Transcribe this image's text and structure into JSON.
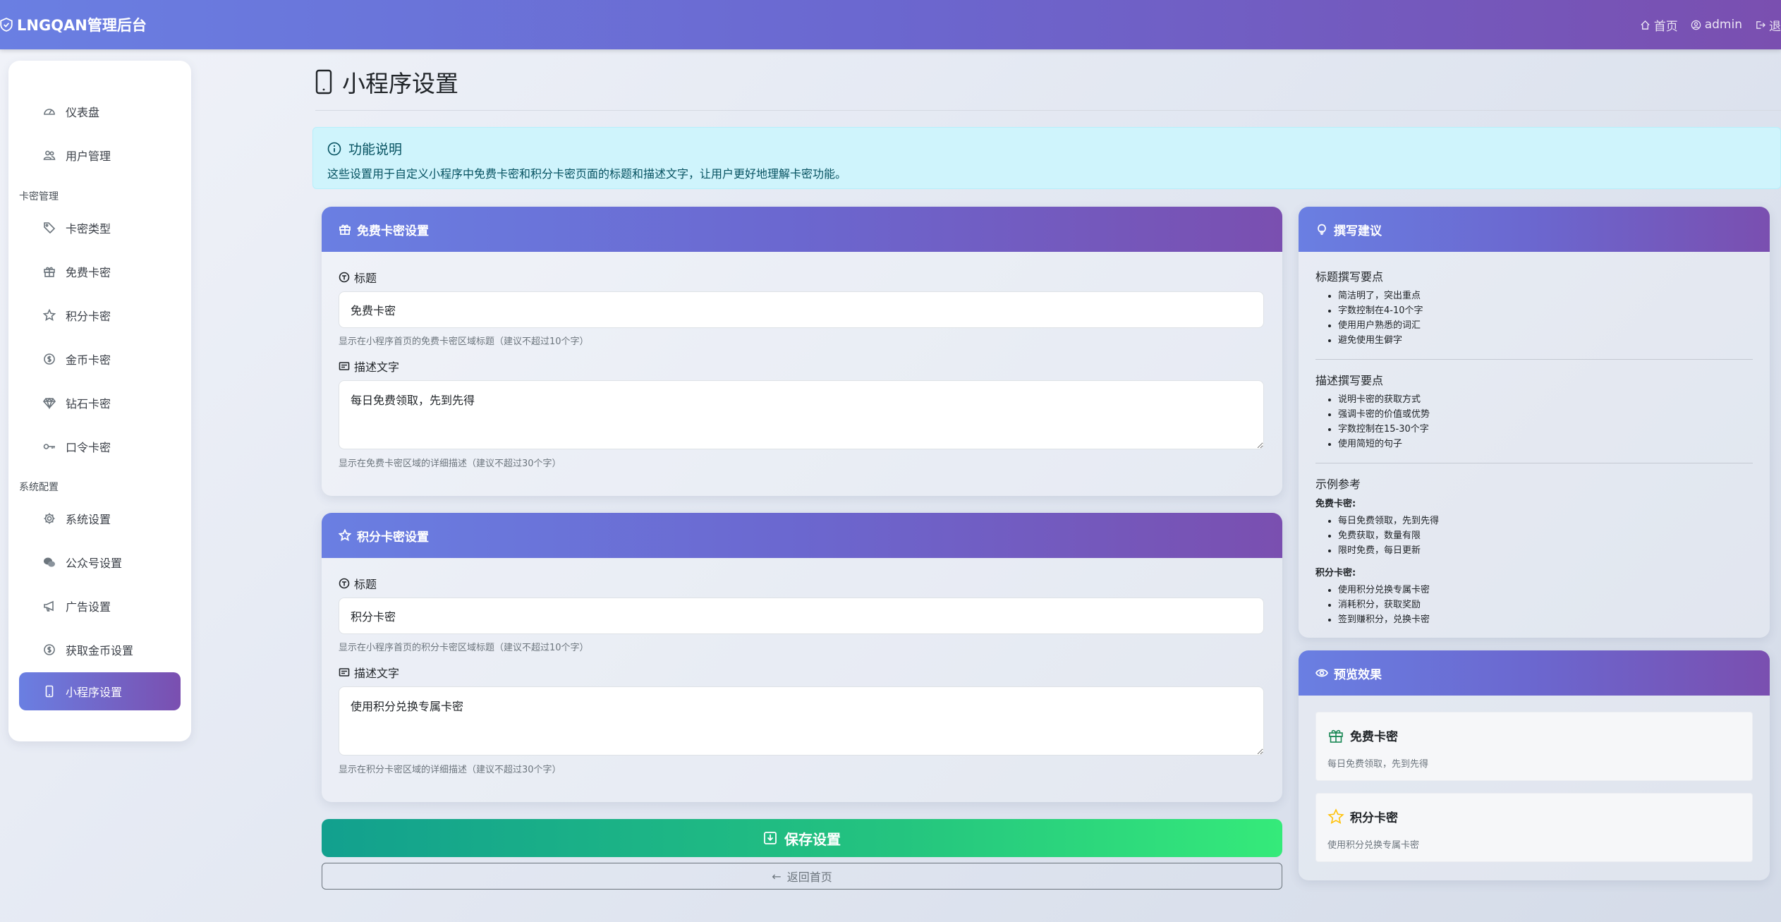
{
  "navbar": {
    "brand": "LNGQAN管理后台",
    "home": "首页",
    "user": "admin",
    "logout": "退"
  },
  "sidebar": {
    "items": [
      {
        "label": "仪表盘",
        "icon": "gauge-icon"
      },
      {
        "label": "用户管理",
        "icon": "people-icon"
      },
      {
        "label": "卡密类型",
        "icon": "tags-icon"
      },
      {
        "label": "免费卡密",
        "icon": "gift-icon"
      },
      {
        "label": "积分卡密",
        "icon": "star-icon"
      },
      {
        "label": "金币卡密",
        "icon": "coin-icon"
      },
      {
        "label": "钻石卡密",
        "icon": "gem-icon"
      },
      {
        "label": "口令卡密",
        "icon": "key-icon"
      },
      {
        "label": "系统设置",
        "icon": "gear-icon"
      },
      {
        "label": "公众号设置",
        "icon": "wechat-icon"
      },
      {
        "label": "广告设置",
        "icon": "megaphone-icon"
      },
      {
        "label": "获取金币设置",
        "icon": "coin-icon"
      },
      {
        "label": "小程序设置",
        "icon": "phone-icon",
        "active": true
      }
    ],
    "sections": [
      "卡密管理",
      "系统配置"
    ]
  },
  "page": {
    "title": "小程序设置"
  },
  "info": {
    "heading": "功能说明",
    "text": "这些设置用于自定义小程序中免费卡密和积分卡密页面的标题和描述文字，让用户更好地理解卡密功能。"
  },
  "free_card": {
    "header": "免费卡密设置",
    "title_label": "标题",
    "title_value": "免费卡密",
    "title_help": "显示在小程序首页的免费卡密区域标题（建议不超过10个字）",
    "desc_label": "描述文字",
    "desc_value": "每日免费领取，先到先得",
    "desc_help": "显示在免费卡密区域的详细描述（建议不超过30个字）"
  },
  "points_card": {
    "header": "积分卡密设置",
    "title_label": "标题",
    "title_value": "积分卡密",
    "title_help": "显示在小程序首页的积分卡密区域标题（建议不超过10个字）",
    "desc_label": "描述文字",
    "desc_value": "使用积分兑换专属卡密",
    "desc_help": "显示在积分卡密区域的详细描述（建议不超过30个字）"
  },
  "actions": {
    "save": "保存设置",
    "back": "返回首页"
  },
  "tips": {
    "header": "撰写建议",
    "title_section": "标题撰写要点",
    "title_points": [
      "简洁明了，突出重点",
      "字数控制在4-10个字",
      "使用用户熟悉的词汇",
      "避免使用生僻字"
    ],
    "desc_section": "描述撰写要点",
    "desc_points": [
      "说明卡密的获取方式",
      "强调卡密的价值或优势",
      "字数控制在15-30个字",
      "使用简短的句子"
    ],
    "example_section": "示例参考",
    "free_label": "免费卡密:",
    "free_examples": [
      "每日免费领取，先到先得",
      "免费获取，数量有限",
      "限时免费，每日更新"
    ],
    "points_label": "积分卡密:",
    "points_examples": [
      "使用积分兑换专属卡密",
      "消耗积分，获取奖励",
      "签到赚积分，兑换卡密"
    ]
  },
  "preview": {
    "header": "预览效果",
    "free_title": "免费卡密",
    "free_desc": "每日免费领取，先到先得",
    "points_title": "积分卡密",
    "points_desc": "使用积分兑换专属卡密"
  },
  "colors": {
    "brand_gradient_start": "#6a7fe2",
    "brand_gradient_end": "#7a4fb0",
    "save_gradient_start": "#12a08e",
    "save_gradient_end": "#35ea7a",
    "info_bg": "#cff4fc",
    "info_text": "#055160"
  }
}
